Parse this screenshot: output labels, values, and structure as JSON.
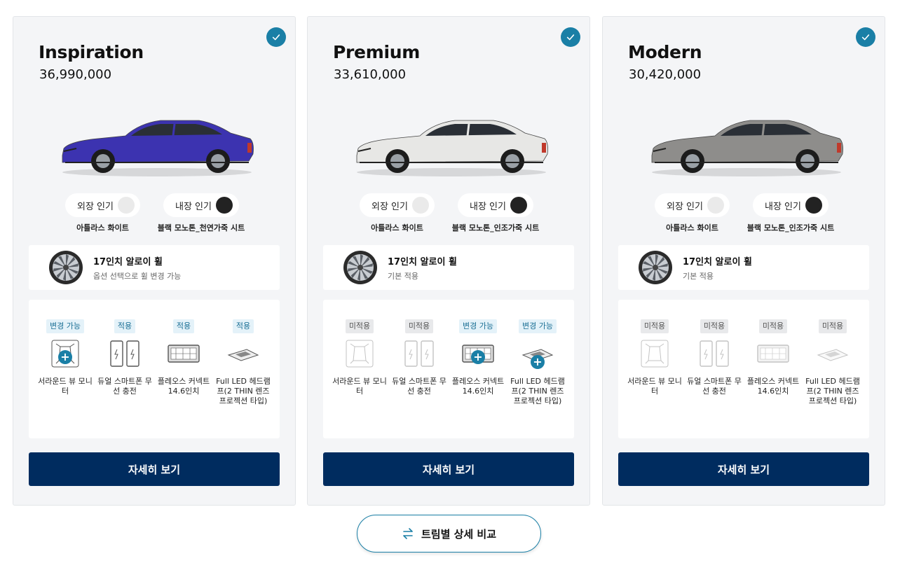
{
  "trims": [
    {
      "name": "Inspiration",
      "price": "36,990,000",
      "body_color": "#3c33b0",
      "selected": true,
      "exterior": {
        "label": "외장 인기",
        "color": "#eaeaea",
        "name": "아틀라스 화이트"
      },
      "interior": {
        "label": "내장 인기",
        "color": "#222222",
        "name": "블랙 모노톤_천연가죽 시트"
      },
      "wheel": {
        "title": "17인치 알로이 휠",
        "desc": "옵션 선택으로 휠 변경 가능"
      },
      "options": [
        {
          "badge": "변경 가능",
          "label": "서라운드 뷰 모니터",
          "status": "change"
        },
        {
          "badge": "적용",
          "label": "듀얼 스마트폰 무선 충전",
          "status": "applied"
        },
        {
          "badge": "적용",
          "label": "플레오스 커넥트 14.6인치",
          "status": "applied"
        },
        {
          "badge": "적용",
          "label": "Full LED 헤드램프(2 THIN 렌즈 프로젝션 타입)",
          "status": "applied"
        }
      ],
      "detail_button": "자세히 보기"
    },
    {
      "name": "Premium",
      "price": "33,610,000",
      "body_color": "#e7e7e5",
      "selected": true,
      "exterior": {
        "label": "외장 인기",
        "color": "#eaeaea",
        "name": "아틀라스 화이트"
      },
      "interior": {
        "label": "내장 인기",
        "color": "#222222",
        "name": "블랙 모노톤_인조가죽 시트"
      },
      "wheel": {
        "title": "17인치 알로이 휠",
        "desc": "기본 적용"
      },
      "options": [
        {
          "badge": "미적용",
          "label": "서라운드 뷰 모니터",
          "status": "none"
        },
        {
          "badge": "미적용",
          "label": "듀얼 스마트폰 무선 충전",
          "status": "none"
        },
        {
          "badge": "변경 가능",
          "label": "플레오스 커넥트 14.6인치",
          "status": "change"
        },
        {
          "badge": "변경 가능",
          "label": "Full LED 헤드램프(2 THIN 렌즈 프로젝션 타입)",
          "status": "change"
        }
      ],
      "detail_button": "자세히 보기"
    },
    {
      "name": "Modern",
      "price": "30,420,000",
      "body_color": "#8e8d8b",
      "selected": true,
      "exterior": {
        "label": "외장 인기",
        "color": "#eaeaea",
        "name": "아틀라스 화이트"
      },
      "interior": {
        "label": "내장 인기",
        "color": "#222222",
        "name": "블랙 모노톤_인조가죽 시트"
      },
      "wheel": {
        "title": "17인치 알로이 휠",
        "desc": "기본 적용"
      },
      "options": [
        {
          "badge": "미적용",
          "label": "서라운드 뷰 모니터",
          "status": "none"
        },
        {
          "badge": "미적용",
          "label": "듀얼 스마트폰 무선 충전",
          "status": "none"
        },
        {
          "badge": "미적용",
          "label": "플레오스 커넥트 14.6인치",
          "status": "none"
        },
        {
          "badge": "미적용",
          "label": "Full LED 헤드램프(2 THIN 렌즈 프로젝션 타입)",
          "status": "none"
        }
      ],
      "detail_button": "자세히 보기"
    }
  ],
  "option_icons": [
    "surround-view-icon",
    "wireless-charging-icon",
    "infotainment-screen-icon",
    "led-headlamp-icon"
  ],
  "compare_button": {
    "label": "트림별 상세 비교",
    "icon": "swap-arrows-icon"
  },
  "colors": {
    "accent": "#1a7fa6",
    "navy": "#002c5f",
    "card_bg": "#f4f5f7"
  }
}
